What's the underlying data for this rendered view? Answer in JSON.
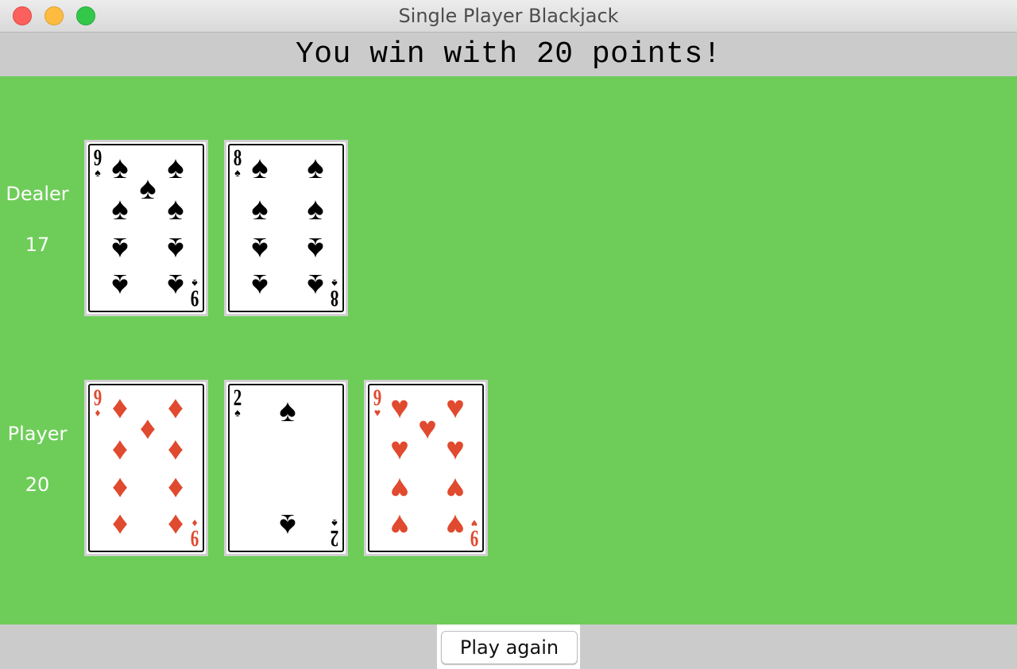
{
  "window": {
    "title": "Single Player Blackjack"
  },
  "status": {
    "message": "You win with 20 points!"
  },
  "dealer": {
    "label": "Dealer",
    "score": "17",
    "cards": [
      {
        "rank": "9",
        "suit": "♠",
        "color": "#000000"
      },
      {
        "rank": "8",
        "suit": "♠",
        "color": "#000000"
      }
    ]
  },
  "player": {
    "label": "Player",
    "score": "20",
    "cards": [
      {
        "rank": "9",
        "suit": "♦",
        "color": "#e04a2f"
      },
      {
        "rank": "2",
        "suit": "♠",
        "color": "#000000"
      },
      {
        "rank": "9",
        "suit": "♥",
        "color": "#e04a2f"
      }
    ]
  },
  "actions": {
    "play_again_label": "Play again"
  },
  "colors": {
    "table_green": "#6ecd59",
    "chrome_gray": "#cbcbcb"
  }
}
